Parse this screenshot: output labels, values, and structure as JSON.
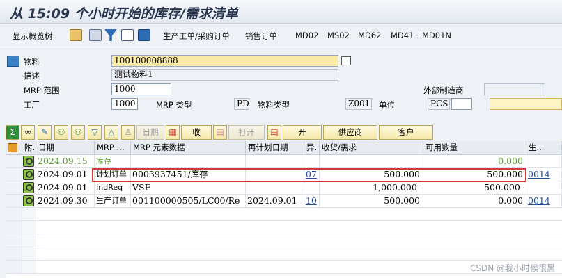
{
  "title": "从 15:09 个小时开始的库存/需求清单",
  "toolbar": {
    "items": [
      "显示概览树",
      "生产工单/采购订单",
      "销售订单",
      "MD02",
      "MS02",
      "MD62",
      "MD41",
      "MD01N"
    ]
  },
  "header": {
    "material_label": "物料",
    "material_value": "100100008888",
    "desc_label": "描述",
    "desc_value": "测试物料1",
    "mrp_area_label": "MRP 范围",
    "mrp_area_value": "1000",
    "plant_label": "工厂",
    "plant_value": "1000",
    "mrp_type_label": "MRP 类型",
    "mrp_type_value": "PD",
    "material_type_label": "物料类型",
    "material_type_value": "Z001",
    "unit_label": "单位",
    "unit_value": "PCS",
    "ext_proc_label": "外部制造商"
  },
  "grid_toolbar": {
    "date_label": "日期",
    "collect_label": "收",
    "open_label": "打开",
    "open2_label": "开",
    "vendor_label": "供应商",
    "customer_label": "客户"
  },
  "columns": [
    "附.",
    "日期",
    "MRP ...",
    "MRP 元素数据",
    "再计划日期",
    "异.",
    "收货/需求",
    "可用数量",
    "生..."
  ],
  "rows": [
    {
      "date": "2024.09.15",
      "elem": "库存",
      "data": "",
      "resched": "",
      "exc": "",
      "qty": "",
      "avail": "0.000",
      "prod": ""
    },
    {
      "date": "2024.09.01",
      "elem": "计划订单",
      "data": "0003937451/库存",
      "resched": "",
      "exc": "07",
      "qty": "500.000",
      "avail": "500.000",
      "prod": "0014"
    },
    {
      "date": "2024.09.01",
      "elem": "IndReq",
      "data": "VSF",
      "resched": "",
      "exc": "",
      "qty": "1,000.000-",
      "avail": "500.000-",
      "prod": ""
    },
    {
      "date": "2024.09.30",
      "elem": "生产订单",
      "data": "001100000505/LC00/Re",
      "resched": "2024.09.01",
      "exc": "10",
      "qty": "500.000",
      "avail": "0.000",
      "prod": "0014"
    }
  ],
  "watermark": "CSDN @我小时候很黑"
}
